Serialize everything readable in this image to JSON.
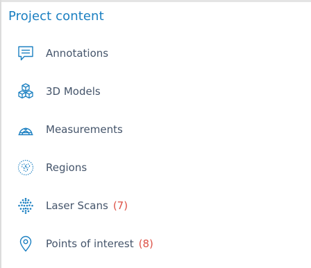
{
  "panel": {
    "title": "Project content",
    "items": [
      {
        "label": "Annotations",
        "count": "",
        "icon": "annotation-icon"
      },
      {
        "label": "3D Models",
        "count": "",
        "icon": "cubes-icon"
      },
      {
        "label": "Measurements",
        "count": "",
        "icon": "measurement-icon"
      },
      {
        "label": "Regions",
        "count": "",
        "icon": "regions-icon"
      },
      {
        "label": "Laser Scans",
        "count": "(7)",
        "icon": "laser-scan-icon"
      },
      {
        "label": "Points of interest",
        "count": "(8)",
        "icon": "location-pin-icon"
      }
    ]
  },
  "colors": {
    "accent": "#1a7fc1",
    "label": "#44546a",
    "count": "#dd5146"
  }
}
